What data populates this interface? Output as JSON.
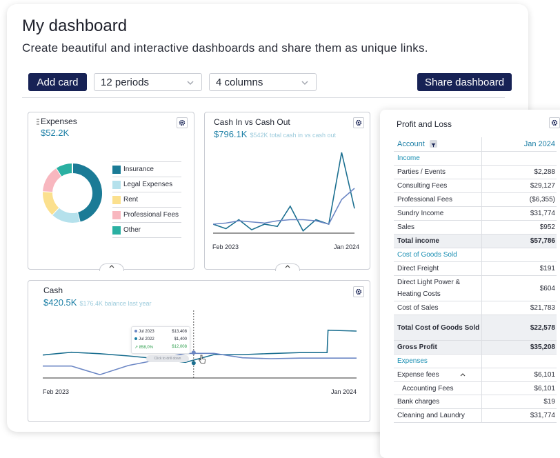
{
  "header": {
    "title": "My dashboard",
    "subtitle": "Create beautiful and interactive dashboards and share them as unique links."
  },
  "toolbar": {
    "add_card": "Add card",
    "periods": "12 periods",
    "columns": "4 columns",
    "share": "Share dashboard"
  },
  "expenses_card": {
    "title": "Expenses",
    "value": "$52.2K",
    "legend": [
      "Insurance",
      "Legal Expenses",
      "Rent",
      "Professional Fees",
      "Other"
    ]
  },
  "cash_flow_card": {
    "title": "Cash In vs Cash Out",
    "value": "$796.1K",
    "sub": "$542K total cash in vs cash out",
    "x_start": "Feb 2023",
    "x_end": "Jan 2024"
  },
  "cash_card": {
    "title": "Cash",
    "value": "$420.5K",
    "sub": "$176.4K balance last year",
    "x_start": "Feb 2023",
    "x_end": "Jan 2024",
    "tooltip": {
      "row1_label": "Jul 2023",
      "row1_value": "$13,408",
      "row2_label": "Jul 2022",
      "row2_value": "$1,400",
      "change": "858,0%",
      "change_value": "$12,008",
      "drill": "Click to drill down"
    }
  },
  "profit_loss": {
    "title": "Profit and Loss",
    "col_account": "Account",
    "col_period": "Jan 2024",
    "rows": [
      {
        "label": "Income",
        "value": "",
        "kind": "section"
      },
      {
        "label": "Parties / Events",
        "value": "$2,288",
        "kind": "row"
      },
      {
        "label": "Consulting Fees",
        "value": "$29,127",
        "kind": "row"
      },
      {
        "label": "Professional Fees",
        "value": "($6,355)",
        "kind": "row"
      },
      {
        "label": "Sundry Income",
        "value": "$31,774",
        "kind": "row"
      },
      {
        "label": "Sales",
        "value": "$952",
        "kind": "row"
      },
      {
        "label": "Total income",
        "value": "$57,786",
        "kind": "total"
      },
      {
        "label": "Cost of Goods Sold",
        "value": "",
        "kind": "section"
      },
      {
        "label": "Direct Freight",
        "value": "$191",
        "kind": "row"
      },
      {
        "label": "Direct Light Power & Heating Costs",
        "value": "$604",
        "kind": "row2"
      },
      {
        "label": "Cost of Sales",
        "value": "$21,783",
        "kind": "row"
      },
      {
        "label": "Total Cost of Goods Sold",
        "value": "$22,578",
        "kind": "total2"
      },
      {
        "label": "Gross Profit",
        "value": "$35,208",
        "kind": "total"
      },
      {
        "label": "Expenses",
        "value": "",
        "kind": "section"
      },
      {
        "label": "Expense fees",
        "value": "$6,101",
        "kind": "expand"
      },
      {
        "label": "Accounting Fees",
        "value": "$6,101",
        "kind": "indent"
      },
      {
        "label": "Bank charges",
        "value": "$19",
        "kind": "row"
      },
      {
        "label": "Cleaning and Laundry",
        "value": "$31,774",
        "kind": "row"
      }
    ]
  },
  "colors": {
    "brand": "#172255",
    "accent": "#1a7ea5",
    "insurance": "#1b7b96",
    "legal": "#b5e1ec",
    "rent": "#fbe08e",
    "professional": "#f8b7bf",
    "other": "#2ab0a2"
  },
  "chart_data": [
    {
      "type": "pie",
      "title": "Expenses",
      "categories": [
        "Insurance",
        "Legal Expenses",
        "Rent",
        "Professional Fees",
        "Other"
      ],
      "values": [
        46,
        16,
        14,
        15,
        9
      ]
    },
    {
      "type": "line",
      "title": "Cash In vs Cash Out",
      "x": [
        "Feb 2023",
        "Mar 2023",
        "Apr 2023",
        "May 2023",
        "Jun 2023",
        "Jul 2023",
        "Aug 2023",
        "Sep 2023",
        "Oct 2023",
        "Nov 2023",
        "Dec 2023",
        "Jan 2024"
      ],
      "series": [
        {
          "values": [
            8,
            4,
            12,
            3,
            8,
            6,
            24,
            2,
            12,
            8,
            72,
            22
          ]
        },
        {
          "values": [
            8,
            9,
            11,
            10,
            9,
            11,
            12,
            12,
            11,
            8,
            30,
            40
          ]
        }
      ]
    },
    {
      "type": "line",
      "title": "Cash",
      "x": [
        "Feb 2023",
        "Mar 2023",
        "Apr 2023",
        "May 2023",
        "Jun 2023",
        "Jul 2023",
        "Aug 2023",
        "Sep 2023",
        "Oct 2023",
        "Nov 2023",
        "Dec 2023",
        "Jan 2024"
      ],
      "series": [
        {
          "values": [
            12.5,
            14,
            13.2,
            12,
            10.5,
            8.5,
            12.7,
            12.7,
            13.3,
            13.8,
            26,
            25.5
          ]
        },
        {
          "values": [
            6.5,
            6.5,
            1.8,
            6.8,
            9.8,
            13.4,
            13.4,
            11,
            10.5,
            10.8,
            10.8,
            10.8
          ]
        }
      ]
    }
  ]
}
